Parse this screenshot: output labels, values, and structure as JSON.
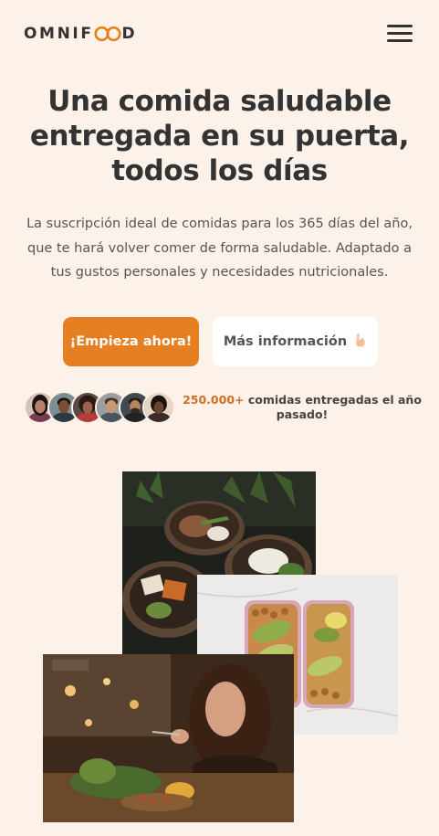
{
  "header": {
    "logo_before": "OMNIF",
    "logo_after": "D",
    "menu_icon": "hamburger-menu-icon"
  },
  "hero": {
    "title": "Una comida saludable entregada en su puerta, todos los días",
    "description": "La suscripción ideal de comidas para los 365 días del año, que te hará volver comer de forma saludable. Adaptado a tus gustos personales y necesidades nutricionales.",
    "primary_button": "¡Empieza ahora!",
    "secondary_button": "Más información",
    "secondary_icon": "pointing-down-hand-icon"
  },
  "delivered": {
    "count": "250.000+",
    "text": " comidas entregadas el año pasado!"
  },
  "colors": {
    "background": "#fdf2e9",
    "accent": "#e67e22",
    "text": "#333333"
  }
}
